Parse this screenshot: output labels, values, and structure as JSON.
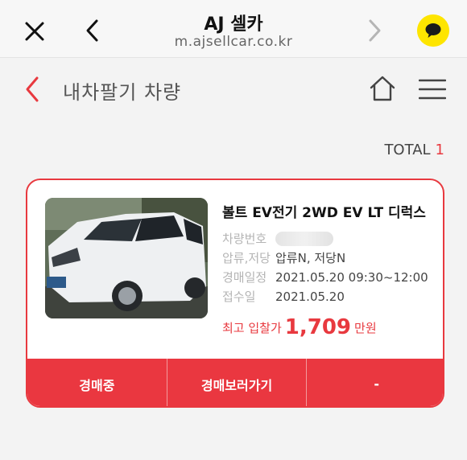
{
  "browser": {
    "title": "AJ 셀카",
    "url": "m.ajsellcar.co.kr",
    "icons": [
      "close-icon",
      "back-icon",
      "forward-icon",
      "kakaotalk-icon"
    ]
  },
  "header": {
    "title": "내차팔기 차량",
    "icons": [
      "back-icon",
      "home-icon",
      "menu-icon"
    ]
  },
  "total": {
    "label": "TOTAL",
    "count": "1"
  },
  "listing": {
    "car_name": "볼트 EV전기 2WD EV LT 디럭스",
    "plate_label": "차량번호",
    "seizure_label": "압류,저당",
    "seizure_value": "압류N, 저당N",
    "auction_date_label": "경매일정",
    "auction_date_value": "2021.05.20 09:30~12:00",
    "received_label": "접수일",
    "received_value": "2021.05.20",
    "bid_label": "최고 입찰가",
    "bid_price": "1,709",
    "bid_unit": "만원",
    "buttons": {
      "status": "경매중",
      "view_auction": "경매보러가기",
      "extra": "-"
    }
  },
  "colors": {
    "accent": "#e8393f",
    "kakao_yellow": "#fee500"
  }
}
